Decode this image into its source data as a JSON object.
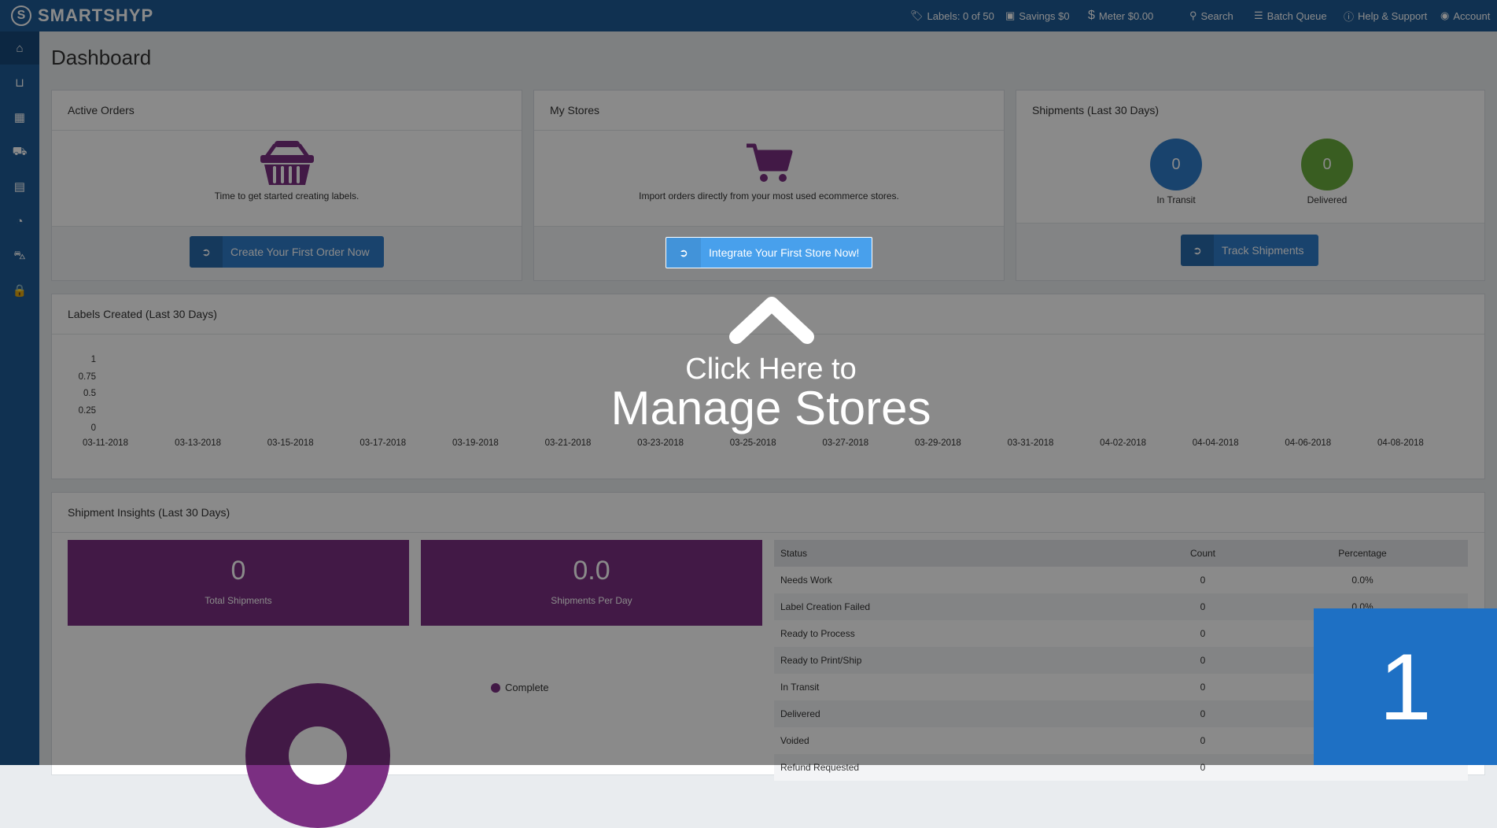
{
  "app": {
    "logo_text": "SMARTSHYP",
    "logo_mark": "S"
  },
  "topbar": {
    "labels": "Labels: 0 of 50",
    "savings": "Savings $0",
    "meter": "Meter $0.00",
    "search": "Search",
    "batch_queue": "Batch Queue",
    "help": "Help & Support",
    "account": "Account"
  },
  "sidebar": {
    "items": [
      {
        "icon": "home-icon"
      },
      {
        "icon": "basket-icon"
      },
      {
        "icon": "calendar-icon"
      },
      {
        "icon": "truck-icon"
      },
      {
        "icon": "address-book-icon"
      },
      {
        "icon": "pie-chart-icon"
      },
      {
        "icon": "cart-icon"
      },
      {
        "icon": "lock-icon"
      }
    ]
  },
  "page": {
    "title": "Dashboard"
  },
  "active_orders": {
    "title": "Active Orders",
    "text": "Time to get started creating labels.",
    "button": "Create Your First Order Now"
  },
  "my_stores": {
    "title": "My Stores",
    "text": "Import orders directly from your most used ecommerce stores.",
    "button": "Integrate Your First Store Now!"
  },
  "shipments": {
    "title": "Shipments (Last 30 Days)",
    "in_transit_count": "0",
    "in_transit_label": "In Transit",
    "delivered_count": "0",
    "delivered_label": "Delivered",
    "button": "Track Shipments",
    "colors": {
      "in_transit": "#2f7cc9",
      "delivered": "#6aad3d"
    }
  },
  "labels_chart": {
    "title": "Labels Created (Last 30 Days)"
  },
  "chart_data": {
    "type": "line",
    "title": "Labels Created (Last 30 Days)",
    "x": [
      "03-11-2018",
      "03-13-2018",
      "03-15-2018",
      "03-17-2018",
      "03-19-2018",
      "03-21-2018",
      "03-23-2018",
      "03-25-2018",
      "03-27-2018",
      "03-29-2018",
      "03-31-2018",
      "04-02-2018",
      "04-04-2018",
      "04-06-2018",
      "04-08-2018"
    ],
    "y_ticks": [
      "1",
      "0.75",
      "0.5",
      "0.25",
      "0"
    ],
    "ylim": [
      0,
      1
    ],
    "series": []
  },
  "insights": {
    "title": "Shipment Insights (Last 30 Days)",
    "total_value": "0",
    "total_label": "Total Shipments",
    "per_day_value": "0.0",
    "per_day_label": "Shipments Per Day",
    "legend_label": "Complete",
    "table": {
      "headers": [
        "Status",
        "Count",
        "Percentage"
      ],
      "rows": [
        [
          "Needs Work",
          "0",
          "0.0%"
        ],
        [
          "Label Creation Failed",
          "0",
          "0.0%"
        ],
        [
          "Ready to Process",
          "0",
          ""
        ],
        [
          "Ready to Print/Ship",
          "0",
          ""
        ],
        [
          "In Transit",
          "0",
          ""
        ],
        [
          "Delivered",
          "0",
          ""
        ],
        [
          "Voided",
          "0",
          ""
        ],
        [
          "Refund Requested",
          "0",
          ""
        ]
      ]
    }
  },
  "tutorial": {
    "line1": "Click Here to",
    "line2": "Manage Stores",
    "step": "1"
  }
}
